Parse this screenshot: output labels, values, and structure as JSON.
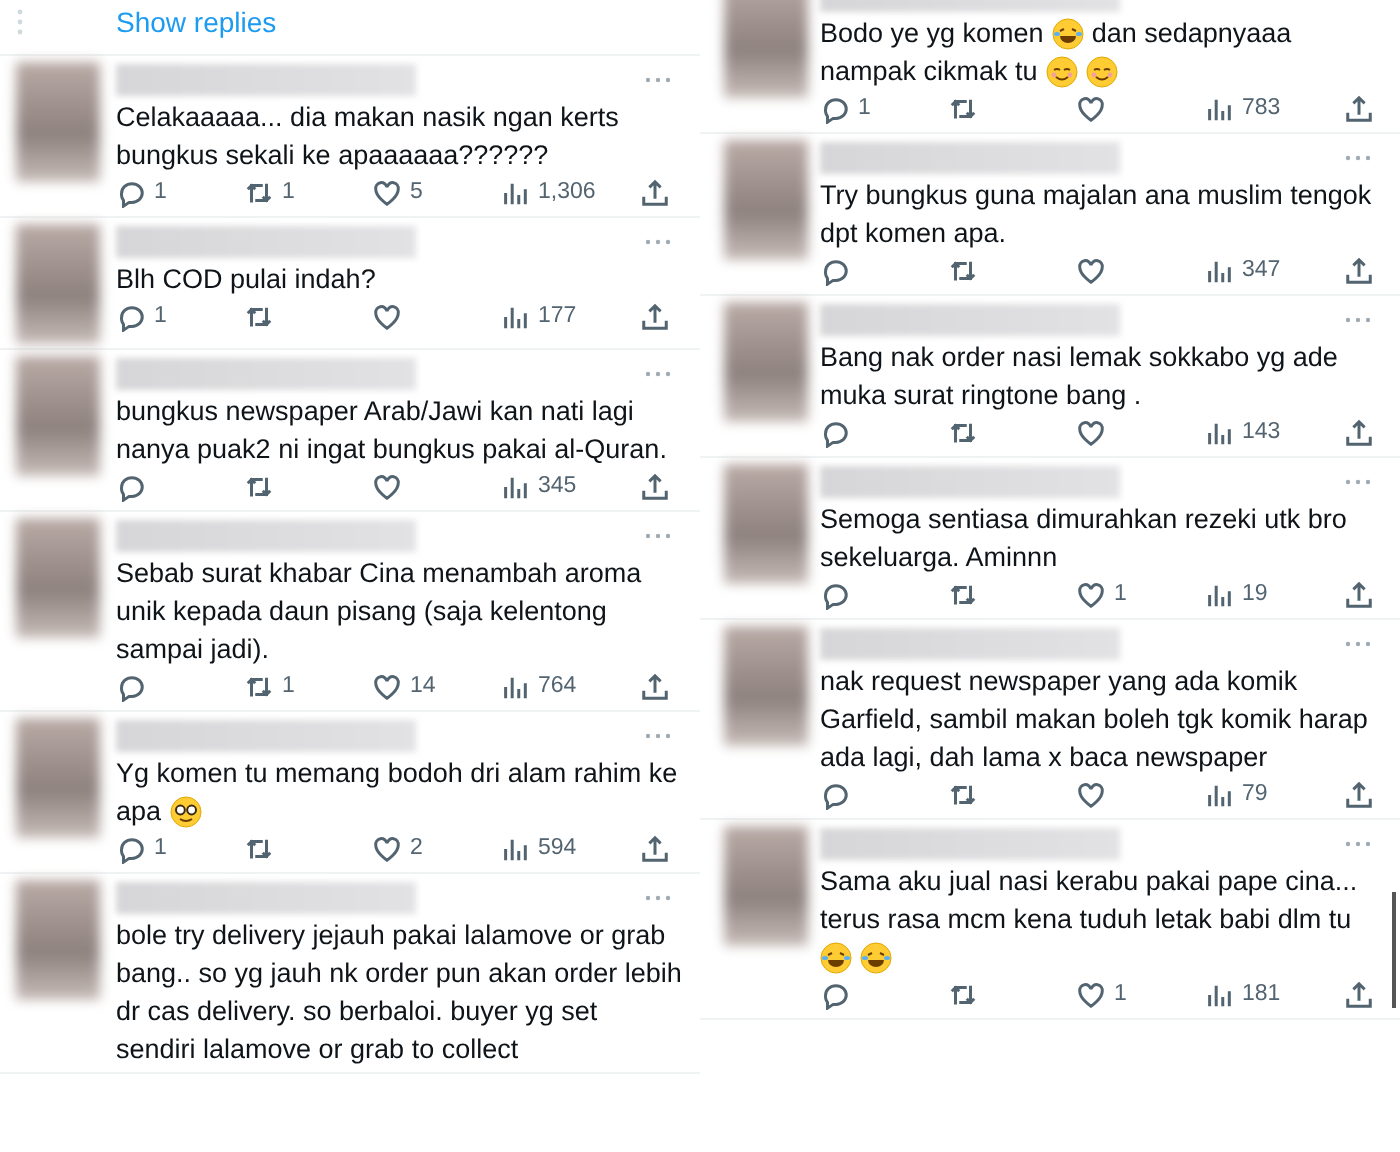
{
  "columns": [
    {
      "header": {
        "label": "Show replies"
      },
      "replies": [
        {
          "lines": [
            [
              {
                "kind": "text",
                "text": "Celakaaaaa... dia makan nasik ngan kerts"
              }
            ],
            [
              {
                "kind": "text",
                "text": "bungkus sekali ke apaaaaaa??????"
              }
            ]
          ],
          "actions": [
            {
              "kind": "reply",
              "count": "1"
            },
            {
              "kind": "retweet",
              "count": "1"
            },
            {
              "kind": "like",
              "count": "5"
            },
            {
              "kind": "views",
              "count": "1,306"
            },
            {
              "kind": "share"
            }
          ]
        },
        {
          "lines": [
            [
              {
                "kind": "text",
                "text": "Blh COD pulai indah?"
              }
            ]
          ],
          "actions": [
            {
              "kind": "reply",
              "count": "1"
            },
            {
              "kind": "retweet"
            },
            {
              "kind": "like"
            },
            {
              "kind": "views",
              "count": "177"
            },
            {
              "kind": "share"
            }
          ]
        },
        {
          "lines": [
            [
              {
                "kind": "text",
                "text": "bungkus newspaper Arab/Jawi kan nati lagi"
              }
            ],
            [
              {
                "kind": "text",
                "text": "nanya puak2 ni ingat bungkus pakai al-Quran."
              }
            ]
          ],
          "actions": [
            {
              "kind": "reply"
            },
            {
              "kind": "retweet"
            },
            {
              "kind": "like"
            },
            {
              "kind": "views",
              "count": "345"
            },
            {
              "kind": "share"
            }
          ]
        },
        {
          "lines": [
            [
              {
                "kind": "text",
                "text": "Sebab surat khabar Cina menambah aroma"
              }
            ],
            [
              {
                "kind": "text",
                "text": "unik kepada daun pisang (saja kelentong"
              }
            ],
            [
              {
                "kind": "text",
                "text": "sampai jadi)."
              }
            ]
          ],
          "actions": [
            {
              "kind": "reply"
            },
            {
              "kind": "retweet",
              "count": "1"
            },
            {
              "kind": "like",
              "count": "14"
            },
            {
              "kind": "views",
              "count": "764"
            },
            {
              "kind": "share"
            }
          ]
        },
        {
          "lines": [
            [
              {
                "kind": "text",
                "text": "Yg komen tu memang bodoh dri alam rahim ke"
              }
            ],
            [
              {
                "kind": "text",
                "text": "apa"
              },
              {
                "kind": "nerd-emoji"
              }
            ]
          ],
          "actions": [
            {
              "kind": "reply",
              "count": "1"
            },
            {
              "kind": "retweet"
            },
            {
              "kind": "like",
              "count": "2"
            },
            {
              "kind": "views",
              "count": "594"
            },
            {
              "kind": "share"
            }
          ]
        },
        {
          "lines": [
            [
              {
                "kind": "text",
                "text": "bole try delivery jejauh pakai lalamove or grab"
              }
            ],
            [
              {
                "kind": "text",
                "text": "bang.. so yg jauh nk order pun akan order lebih"
              }
            ],
            [
              {
                "kind": "text",
                "text": "dr cas delivery. so berbaloi. buyer yg set"
              }
            ],
            [
              {
                "kind": "text",
                "text": "sendiri lalamove or grab to collect"
              }
            ]
          ]
        }
      ]
    },
    {
      "replies": [
        {
          "lines": [
            [
              {
                "kind": "text",
                "text": "Bodo ye yg komen"
              },
              {
                "kind": "laugh-emoji"
              },
              {
                "kind": "text",
                "text": "dan sedapnyaaa"
              }
            ],
            [
              {
                "kind": "text",
                "text": "nampak cikmak tu"
              },
              {
                "kind": "smile-emoji"
              },
              {
                "kind": "smile-emoji"
              }
            ]
          ],
          "actions": [
            {
              "kind": "reply",
              "count": "1"
            },
            {
              "kind": "retweet"
            },
            {
              "kind": "like"
            },
            {
              "kind": "views",
              "count": "783"
            },
            {
              "kind": "share"
            }
          ]
        },
        {
          "lines": [
            [
              {
                "kind": "text",
                "text": "Try bungkus guna majalan ana muslim tengok"
              }
            ],
            [
              {
                "kind": "text",
                "text": "dpt komen apa."
              }
            ]
          ],
          "actions": [
            {
              "kind": "reply"
            },
            {
              "kind": "retweet"
            },
            {
              "kind": "like"
            },
            {
              "kind": "views",
              "count": "347"
            },
            {
              "kind": "share"
            }
          ]
        },
        {
          "lines": [
            [
              {
                "kind": "text",
                "text": "Bang nak order nasi lemak sokkabo yg ade"
              }
            ],
            [
              {
                "kind": "text",
                "text": "muka surat ringtone bang ."
              }
            ]
          ],
          "actions": [
            {
              "kind": "reply"
            },
            {
              "kind": "retweet"
            },
            {
              "kind": "like"
            },
            {
              "kind": "views",
              "count": "143"
            },
            {
              "kind": "share"
            }
          ]
        },
        {
          "lines": [
            [
              {
                "kind": "text",
                "text": "Semoga sentiasa dimurahkan rezeki utk bro"
              }
            ],
            [
              {
                "kind": "text",
                "text": "sekeluarga. Aminnn"
              }
            ]
          ],
          "actions": [
            {
              "kind": "reply"
            },
            {
              "kind": "retweet"
            },
            {
              "kind": "like",
              "count": "1"
            },
            {
              "kind": "views",
              "count": "19"
            },
            {
              "kind": "share"
            }
          ]
        },
        {
          "lines": [
            [
              {
                "kind": "text",
                "text": "nak request newspaper yang ada komik"
              }
            ],
            [
              {
                "kind": "text",
                "text": "Garfield, sambil makan boleh tgk komik harap"
              }
            ],
            [
              {
                "kind": "text",
                "text": "ada lagi, dah lama x baca newspaper"
              }
            ]
          ],
          "actions": [
            {
              "kind": "reply"
            },
            {
              "kind": "retweet"
            },
            {
              "kind": "like"
            },
            {
              "kind": "views",
              "count": "79"
            },
            {
              "kind": "share"
            }
          ]
        },
        {
          "lines": [
            [
              {
                "kind": "text",
                "text": "Sama aku jual nasi kerabu pakai pape cina..."
              }
            ],
            [
              {
                "kind": "text",
                "text": "terus rasa mcm kena tuduh letak babi dlm tu"
              }
            ],
            [
              {
                "kind": "laugh-emoji"
              },
              {
                "kind": "laugh-emoji"
              }
            ]
          ],
          "actions": [
            {
              "kind": "reply"
            },
            {
              "kind": "retweet"
            },
            {
              "kind": "like",
              "count": "1"
            },
            {
              "kind": "views",
              "count": "181"
            },
            {
              "kind": "share"
            }
          ]
        }
      ]
    }
  ]
}
